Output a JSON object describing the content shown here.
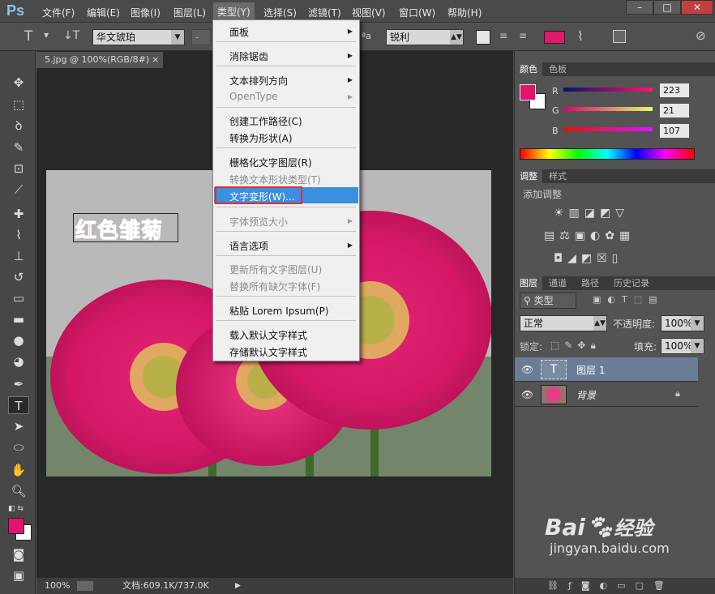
{
  "app": {
    "logo": "Ps"
  },
  "menubar": {
    "items": [
      "文件(F)",
      "编辑(E)",
      "图像(I)",
      "图层(L)",
      "类型(Y)",
      "选择(S)",
      "滤镜(T)",
      "视图(V)",
      "窗口(W)",
      "帮助(H)"
    ],
    "active_index": 4,
    "window_buttons": [
      "–",
      "□",
      "✕"
    ]
  },
  "options_bar": {
    "font_family": "华文琥珀",
    "font_style": "-",
    "aa_icon": "ªa",
    "antialias": "锐利",
    "text_color": "#e0196b"
  },
  "document": {
    "tab_label": "5.jpg @ 100%(RGB/8#)",
    "tab_close": "×",
    "text_layer_content": "红色雏菊",
    "text_color": "#e0196b"
  },
  "status": {
    "zoom": "100%",
    "doc_info": "文档:609.1K/737.0K"
  },
  "dropdown": {
    "items": [
      {
        "label": "面板",
        "submenu": true,
        "disabled": false
      },
      {
        "label": "消除锯齿",
        "submenu": true,
        "disabled": false
      },
      {
        "label": "文本排列方向",
        "submenu": true,
        "disabled": false
      },
      {
        "label": "OpenType",
        "submenu": true,
        "disabled": true
      },
      {
        "label": "创建工作路径(C)",
        "submenu": false,
        "disabled": false
      },
      {
        "label": "转换为形状(A)",
        "submenu": false,
        "disabled": false
      },
      {
        "label": "栅格化文字图层(R)",
        "submenu": false,
        "disabled": false
      },
      {
        "label": "转换文本形状类型(T)",
        "submenu": false,
        "disabled": true
      },
      {
        "label": "文字变形(W)...",
        "submenu": false,
        "disabled": false,
        "highlighted": true
      },
      {
        "label": "字体预览大小",
        "submenu": true,
        "disabled": true
      },
      {
        "label": "语言选项",
        "submenu": true,
        "disabled": false
      },
      {
        "label": "更新所有文字图层(U)",
        "submenu": false,
        "disabled": true
      },
      {
        "label": "替换所有缺欠字体(F)",
        "submenu": false,
        "disabled": true
      },
      {
        "label": "粘贴 Lorem Ipsum(P)",
        "submenu": false,
        "disabled": false
      },
      {
        "label": "载入默认文字样式",
        "submenu": false,
        "disabled": false
      },
      {
        "label": "存储默认文字样式",
        "submenu": false,
        "disabled": false
      }
    ]
  },
  "color_panel": {
    "tabs": [
      "颜色",
      "色板"
    ],
    "channels": [
      {
        "label": "R",
        "value": "223"
      },
      {
        "label": "G",
        "value": "21"
      },
      {
        "label": "B",
        "value": "107"
      }
    ],
    "foreground": "#df156b",
    "background": "#ffffff"
  },
  "adjust_panel": {
    "tabs": [
      "调整",
      "样式"
    ],
    "title": "添加调整"
  },
  "layers_panel": {
    "tabs": [
      "图层",
      "通道",
      "路径",
      "历史记录"
    ],
    "filter_label": "类型",
    "blend_mode": "正常",
    "opacity_label": "不透明度:",
    "opacity_value": "100%",
    "lock_label": "锁定:",
    "fill_label": "填充:",
    "fill_value": "100%",
    "layers": [
      {
        "name": "图层 1",
        "thumb": "T",
        "selected": true
      },
      {
        "name": "背景",
        "thumb": "",
        "selected": false
      }
    ],
    "footer_icons": [
      "link-icon",
      "fx-icon",
      "mask-icon",
      "adjustment-icon",
      "folder-icon",
      "new-layer-icon",
      "trash-icon"
    ]
  },
  "watermark": {
    "brand": "Bai",
    "brand2": "经验",
    "url": "jingyan.baidu.com"
  }
}
